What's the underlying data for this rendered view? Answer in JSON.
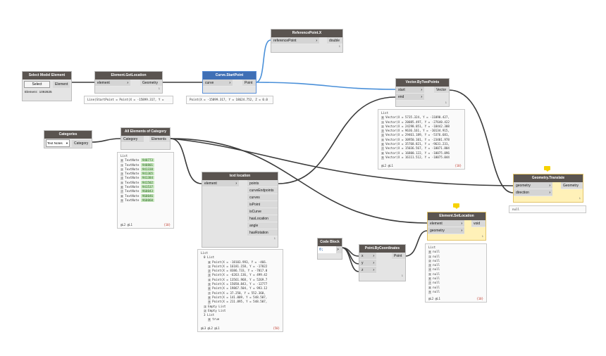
{
  "nodes": {
    "select_model_element": {
      "title": "Select Model Element",
      "button": "Select",
      "output": "Element",
      "info": "Element : 1092825"
    },
    "get_location": {
      "title": "Element.GetLocation",
      "input": "element",
      "output": "Geometry",
      "footer": "1",
      "preview": "Line(StartPoint = Point(X = -15899.317, Y ="
    },
    "start_point": {
      "title": "Curve.StartPoint",
      "input": "curve",
      "output": "Point",
      "preview": "Point(X = -15899.317, Y = 18624.752, Z = 0.0"
    },
    "reference_point": {
      "title": "ReferencePoint.X",
      "input": "referencePoint",
      "output": "double",
      "footer": "1"
    },
    "vector": {
      "title": "Vector.ByTwoPoints",
      "inputs": [
        "start",
        "end"
      ],
      "output": "Vector",
      "footer": "1",
      "preview": {
        "header": "List",
        "rows": [
          "Vector(X = 5735.324, Y = -11090.427,",
          "Vector(X = 20085.497, Y = -27640.422",
          "Vector(X = 24298.051, Y = -18442.308",
          "Vector(X = 9636.161, Y = -10134.915,",
          "Vector(X = 29461.189, Y = -5376.681,",
          "Vector(X = 30950.101, Y = -23401.978",
          "Vector(X = 35768.821, Y = -9631.231,",
          "Vector(X = 15036.567, Y = -10071.804",
          "Vector(X = 16800.122, Y = -10075.096",
          "Vector(X = 16111.512, Y = -10075.044"
        ],
        "levels": "@L2 @L1",
        "count": "{10}"
      }
    },
    "categories": {
      "title": "Categories",
      "value": "Text Notes",
      "output": "Category"
    },
    "all_elements": {
      "title": "All Elements of Category",
      "input": "Category",
      "output": "Elements",
      "preview": {
        "header": "List",
        "items": [
          [
            "TextNote",
            "940773"
          ],
          [
            "TextNote",
            "940801"
          ],
          [
            "TextNote",
            "941338"
          ],
          [
            "TextNote",
            "941365"
          ],
          [
            "TextNote",
            "941384"
          ],
          [
            "TextNote",
            "941502"
          ],
          [
            "TextNote",
            "941537"
          ],
          [
            "TextNote",
            "960043"
          ],
          [
            "TextNote",
            "960046"
          ],
          [
            "TextNote",
            "960060"
          ]
        ],
        "levels": "@L2 @L1",
        "count": "{10}"
      }
    },
    "text_location": {
      "title": "text location",
      "input": "element",
      "outputs": [
        "points",
        "curveEndpoints",
        "curves",
        "isPoint",
        "isCurve",
        "hasLocation",
        "angle",
        "hasRotation"
      ],
      "footer": "1",
      "preview": {
        "header": "List",
        "sub": "0 List",
        "rows": [
          "Point(X = -18103.993, Y = -466.",
          "Point(X = 16181.158, Y = -17822",
          "Point(X = 8386.733, Y = -7817.0",
          "Point(X = -6263.136, Y = 499.42",
          "Point(X = 13561.968, Y = 5269.7",
          "Point(X = 15050.843, Y = -12777",
          "Point(X = 19867.504, Y = 993.12",
          "Point(X = 37.250, Y = 552.360,",
          "Point(X = 141.009, Y = 548.507,",
          "Point(X = 211.895, Y = 548.507,"
        ],
        "empty1": "Empty List",
        "empty2": "Empty List",
        "sub2": "3 List",
        "true_row": "true",
        "levels": "@L3 @L2 @L1",
        "count": "{50}"
      }
    },
    "translate": {
      "title": "Geometry.Translate",
      "inputs": [
        "geometry",
        "direction"
      ],
      "output": "Geometry",
      "footer": "1",
      "preview": "null"
    },
    "set_location": {
      "title": "Element.SetLocation",
      "inputs": [
        "element",
        "geometry"
      ],
      "output": "void",
      "footer": "1",
      "preview": {
        "header": "List",
        "value": "null",
        "count_items": 10,
        "levels": "@L2 @L1",
        "count": "{10}"
      }
    },
    "code_block": {
      "title": "Code Block",
      "code": "0;",
      "output": ">"
    },
    "by_coordinates": {
      "title": "Point.ByCoordinates",
      "inputs": [
        "x",
        "y",
        "z"
      ],
      "output": "Point",
      "footer": "1"
    }
  },
  "colors": {
    "header": "#5a5450",
    "selected": "#3f6fb5",
    "wire": "#3a3a3a",
    "wire_selected": "#4a90d9",
    "note": "#f6d200"
  }
}
